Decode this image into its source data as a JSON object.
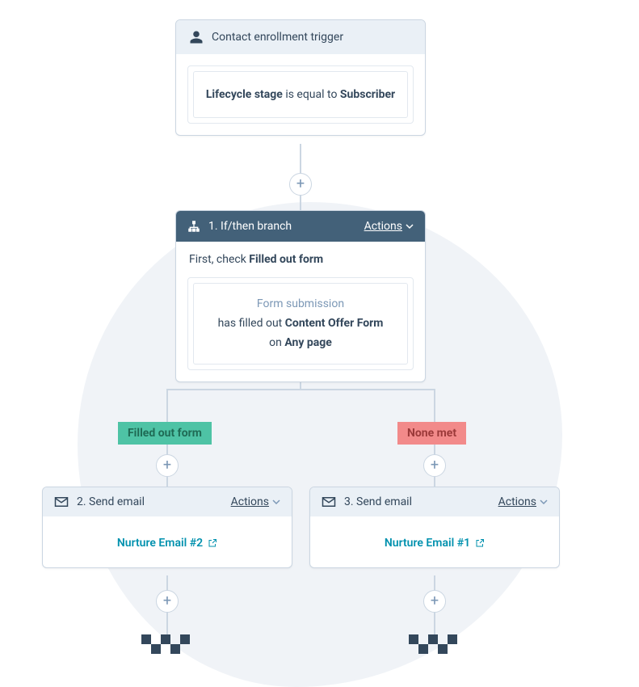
{
  "trigger": {
    "title": "Contact enrollment trigger",
    "rule_field": "Lifecycle stage",
    "rule_op": "is equal to",
    "rule_value": "Subscriber"
  },
  "branch": {
    "title": "1. If/then branch",
    "actions_label": "Actions",
    "subhead_prefix": "First, check",
    "subhead_bold": "Filled out form",
    "rule_line1": "Form submission",
    "rule_line2_pre": "has filled out",
    "rule_line2_bold": "Content Offer Form",
    "rule_line3_pre": "on",
    "rule_line3_bold": "Any page",
    "chip_yes": "Filled out form",
    "chip_no": "None met"
  },
  "email_left": {
    "header": "2. Send email",
    "actions_label": "Actions",
    "link": "Nurture Email #2"
  },
  "email_right": {
    "header": "3. Send email",
    "actions_label": "Actions",
    "link": "Nurture Email #1"
  }
}
